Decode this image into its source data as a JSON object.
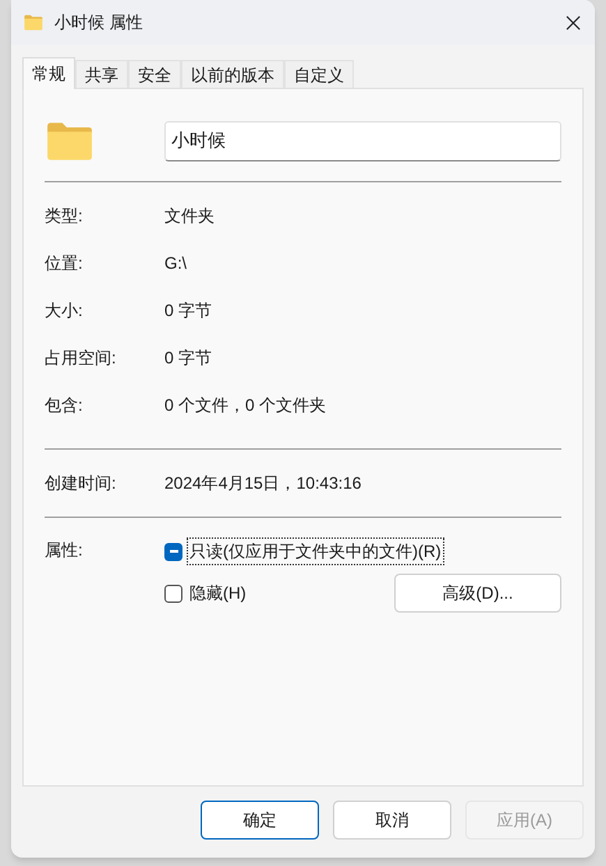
{
  "window": {
    "title": "小时候 属性"
  },
  "tabs": [
    {
      "label": "常规",
      "selected": true
    },
    {
      "label": "共享",
      "selected": false
    },
    {
      "label": "安全",
      "selected": false
    },
    {
      "label": "以前的版本",
      "selected": false
    },
    {
      "label": "自定义",
      "selected": false
    }
  ],
  "name_field": {
    "value": "小时候"
  },
  "info_groups": [
    [
      {
        "label": "类型:",
        "value": "文件夹"
      },
      {
        "label": "位置:",
        "value": "G:\\"
      },
      {
        "label": "大小:",
        "value": "0 字节"
      },
      {
        "label": "占用空间:",
        "value": "0 字节"
      },
      {
        "label": "包含:",
        "value": "0 个文件，0 个文件夹"
      }
    ],
    [
      {
        "label": "创建时间:",
        "value": "2024年4月15日，10:43:16"
      }
    ]
  ],
  "attributes": {
    "label": "属性:",
    "options": [
      {
        "label": "只读(仅应用于文件夹中的文件)(R)",
        "checked": true,
        "indeterminate": true,
        "focused": true
      },
      {
        "label": "隐藏(H)",
        "checked": false,
        "indeterminate": false,
        "focused": false
      }
    ],
    "advanced_button": "高级(D)..."
  },
  "buttons": [
    {
      "label": "确定",
      "default": true,
      "disabled": false
    },
    {
      "label": "取消",
      "default": false,
      "disabled": false
    },
    {
      "label": "应用(A)",
      "default": false,
      "disabled": true
    }
  ]
}
